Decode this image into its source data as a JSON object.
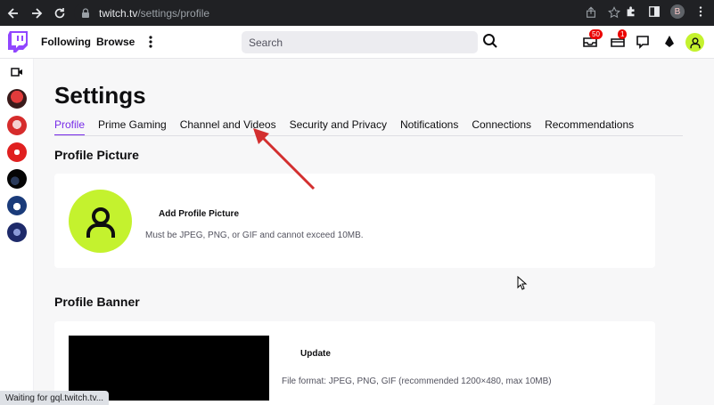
{
  "browser": {
    "url_host": "twitch.tv",
    "url_path": "/settings/profile",
    "profile_initial": "B"
  },
  "topnav": {
    "following_label": "Following",
    "browse_label": "Browse",
    "search_placeholder": "Search",
    "inbox_badge": "50",
    "whispers_badge": "1"
  },
  "page": {
    "title": "Settings",
    "tabs": [
      {
        "label": "Profile",
        "active": true
      },
      {
        "label": "Prime Gaming",
        "active": false
      },
      {
        "label": "Channel and Videos",
        "active": false
      },
      {
        "label": "Security and Privacy",
        "active": false
      },
      {
        "label": "Notifications",
        "active": false
      },
      {
        "label": "Connections",
        "active": false
      },
      {
        "label": "Recommendations",
        "active": false
      }
    ]
  },
  "profile_picture": {
    "title": "Profile Picture",
    "add_label": "Add Profile Picture",
    "hint": "Must be JPEG, PNG, or GIF and cannot exceed 10MB."
  },
  "profile_banner": {
    "title": "Profile Banner",
    "update_label": "Update",
    "hint": "File format: JPEG, PNG, GIF (recommended 1200×480, max 10MB)"
  },
  "status_bar": {
    "text": "Waiting for gql.twitch.tv..."
  },
  "colors": {
    "accent": "#772ce8",
    "avatar_green": "#c4f22e",
    "annotation_arrow": "#d32f2f"
  }
}
